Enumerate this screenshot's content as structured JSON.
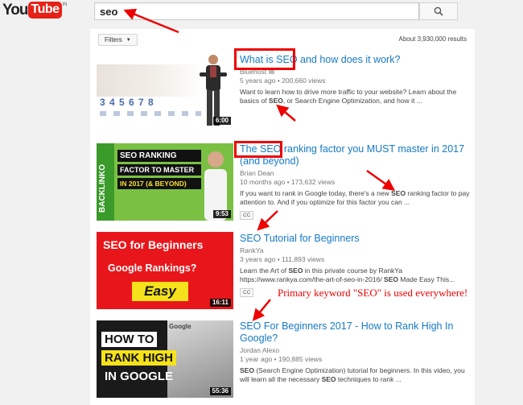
{
  "header": {
    "logo_you": "You",
    "logo_tube": "Tube",
    "logo_region": "IN",
    "search_value": "seo"
  },
  "filters_label": "Filters",
  "results_count": "About 3,930,000 results",
  "results": [
    {
      "title": "What is SEO and how does it work?",
      "channel": "Bluehost",
      "meta": "5 years ago • 200,660 views",
      "description": "Want to learn how to drive more traffic to your website? Learn about the basics of SEO, or Search Engine Optimization, and how it ...",
      "duration": "6:00",
      "thumb_digits": "3 4 5 6 7 8"
    },
    {
      "title": "The SEO ranking factor you MUST master in 2017 (and beyond)",
      "channel": "Brian Dean",
      "meta": "10 months ago • 173,632 views",
      "description": "If you want to rank in Google today, there's a new SEO ranking factor to pay attention to. And if you optimize for this factor you can ...",
      "badge": "CC",
      "duration": "9:53",
      "thumb_text": [
        "SEO RANKING",
        "FACTOR TO MASTER",
        "IN 2017 (& BEYOND)"
      ],
      "thumb_side": "BACKLINKO"
    },
    {
      "title": "SEO Tutorial for Beginners",
      "channel": "RankYa",
      "meta": "3 years ago • 111,893 views",
      "description": "Learn the Art of SEO in this private course by RankYa https://www.rankya.com/the-art-of-seo-in-2016/ SEO Made Easy This...",
      "badge": "CC",
      "duration": "16:11",
      "thumb_text": [
        "SEO  for Beginners",
        "Google Rankings?",
        "Easy"
      ]
    },
    {
      "title": "SEO For Beginners 2017 - How to Rank High In Google?",
      "channel": "Jordan Alexo",
      "meta": "1 year ago • 190,885 views",
      "description": "SEO (Search Engine Optimization) tutorial for beginners. In this video, you will learn all the necessary SEO techniques to rank ...",
      "duration": "55:36",
      "thumb_text": [
        "HOW TO",
        "RANK HIGH",
        "IN GOOGLE"
      ],
      "thumb_brand": "Google"
    }
  ],
  "annotation": "Primary keyword \"SEO\" is used everywhere!",
  "colors": {
    "link": "#167ac6",
    "annotation": "#e00000",
    "youtube_red": "#e62117"
  }
}
